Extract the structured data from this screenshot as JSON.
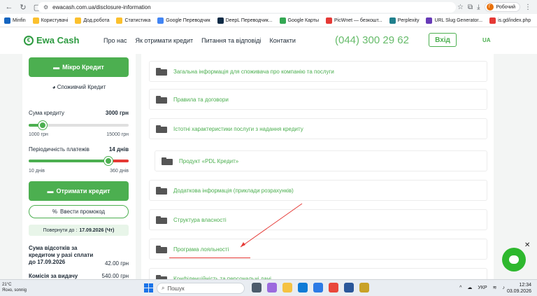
{
  "browser": {
    "url": "ewacash.com.ua/disclosure-information",
    "profile_name": "Робочий",
    "profile_initial": "Г"
  },
  "bookmarks": [
    {
      "label": "Minfin",
      "color": "#1565c0"
    },
    {
      "label": "Користувачі",
      "color": "#fbc02d"
    },
    {
      "label": "Дод.робота",
      "color": "#fbc02d"
    },
    {
      "label": "Статистика",
      "color": "#fbc02d"
    },
    {
      "label": "Google Переводчик",
      "color": "#4285f4"
    },
    {
      "label": "DeepL Переводчик...",
      "color": "#0f2b46"
    },
    {
      "label": "Google Карты",
      "color": "#34a853"
    },
    {
      "label": "PicWnet — безкошт...",
      "color": "#e53935"
    },
    {
      "label": "Perplexity",
      "color": "#20808d"
    },
    {
      "label": "URL Slug Generator...",
      "color": "#673ab7"
    },
    {
      "label": "is.gd/index.php",
      "color": "#e53935"
    }
  ],
  "header": {
    "logo_text": "Ewa Cash",
    "menu": [
      "Про нас",
      "Як отримати кредит",
      "Питання та відповіді",
      "Контакти"
    ],
    "phone": "(044) 300 29 62",
    "login_label": "Вхід",
    "lang": "UA"
  },
  "calculator": {
    "micro_credit_label": "Мікро Кредит",
    "consumer_credit_label": "Споживчий Кредит",
    "amount_label": "Сума кредиту",
    "amount_value": "3000 грн",
    "amount_min": "1000 грн",
    "amount_max": "15000 грн",
    "amount_fraction": 0.14,
    "period_label": "Періодичність платежів",
    "period_value": "14 днів",
    "period_min": "10 днів",
    "period_max": "360 днів",
    "period_fraction": 0.8,
    "get_credit_label": "Отримати кредит",
    "promo_label": "Ввести промокод",
    "return_prefix": "Повернути до :",
    "return_date": "17.09.2026 (Чт)",
    "interest_label": "Сума відсотків за кредитом у разі сплати до 17.09.2026",
    "interest_value": "42.00 грн",
    "fee_label": "Комісія за видачу",
    "fee_value": "540.00 грн"
  },
  "documents": [
    {
      "label": "Загальна інформація для споживача про компанію та послуги",
      "sub": false
    },
    {
      "label": "Правила та договори",
      "sub": false
    },
    {
      "label": "Істотні характеристики послуги з надання кредиту",
      "sub": false
    },
    {
      "label": "Продукт «PDL Кредит»",
      "sub": true
    },
    {
      "label": "Додаткова інформація (приклади розрахунків)",
      "sub": false
    },
    {
      "label": "Структура власності",
      "sub": false
    },
    {
      "label": "Програма лояльності",
      "sub": false
    },
    {
      "label": "Конфіденційність та персональні дані",
      "sub": false
    }
  ],
  "taskbar": {
    "weather_temp": "21°C",
    "weather_desc": "Ясно, sonnig",
    "search_placeholder": "Пошук",
    "lang": "УКР",
    "time": "12:34",
    "date": "03.09.2026"
  }
}
